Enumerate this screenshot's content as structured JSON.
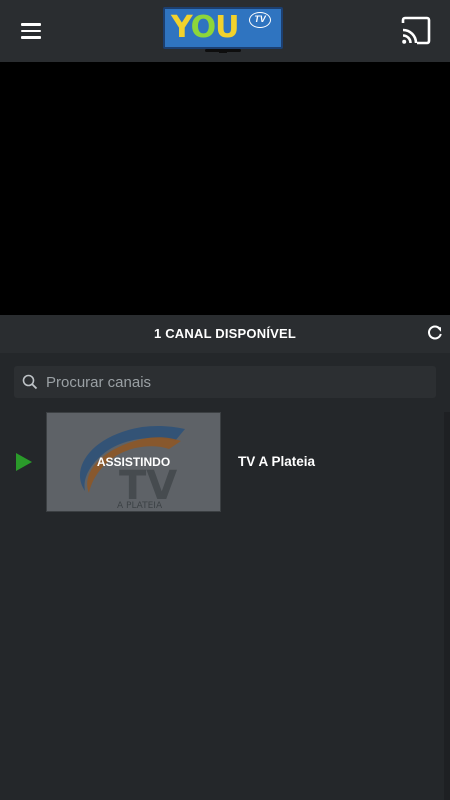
{
  "topbar": {
    "logo_text_you": "YOU",
    "logo_text_tv": "TV"
  },
  "channels": {
    "count_label": "1 CANAL DISPONÍVEL",
    "search": {
      "placeholder": "Procurar canais",
      "value": ""
    },
    "items": [
      {
        "name": "TV A Plateia",
        "status_label": "ASSISTINDO",
        "thumb_logo_text": "TV",
        "thumb_logo_subtext": "A PLATEIA",
        "is_playing": true
      }
    ]
  },
  "colors": {
    "topbar_bg": "#2a2d30",
    "page_bg": "#24272a",
    "player_bg": "#000000",
    "play_indicator": "#2a9a2a",
    "logo_blue": "#2f74c0",
    "logo_yellow": "#f2d22c",
    "logo_green": "#8dd63a"
  },
  "icons": {
    "menu": "hamburger-icon",
    "cast": "cast-icon",
    "refresh": "refresh-icon",
    "search": "search-icon",
    "play": "play-icon"
  }
}
